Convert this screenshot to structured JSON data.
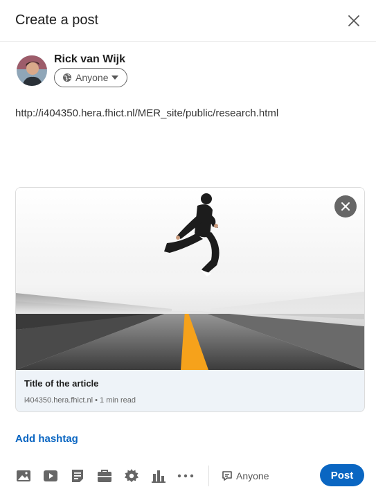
{
  "dialog": {
    "title": "Create a post",
    "close_icon": "close-icon"
  },
  "author": {
    "name": "Rick van Wijk",
    "audience": "Anyone"
  },
  "post": {
    "text": "http://i404350.hera.fhict.nl/MER_site/public/research.html"
  },
  "link_preview": {
    "title": "Title of the article",
    "meta": "i404350.hera.fhict.nl • 1 min read",
    "remove_icon": "close-icon"
  },
  "actions": {
    "add_hashtag": "Add hashtag",
    "comment_audience": "Anyone",
    "post_label": "Post"
  },
  "toolbar_icons": [
    "photo-icon",
    "video-icon",
    "document-icon",
    "job-icon",
    "celebrate-icon",
    "poll-icon",
    "more-icon",
    "comment-icon"
  ],
  "colors": {
    "primary": "#0a66c2",
    "preview_bg": "#eef3f8",
    "road_line": "#f6a21b"
  }
}
